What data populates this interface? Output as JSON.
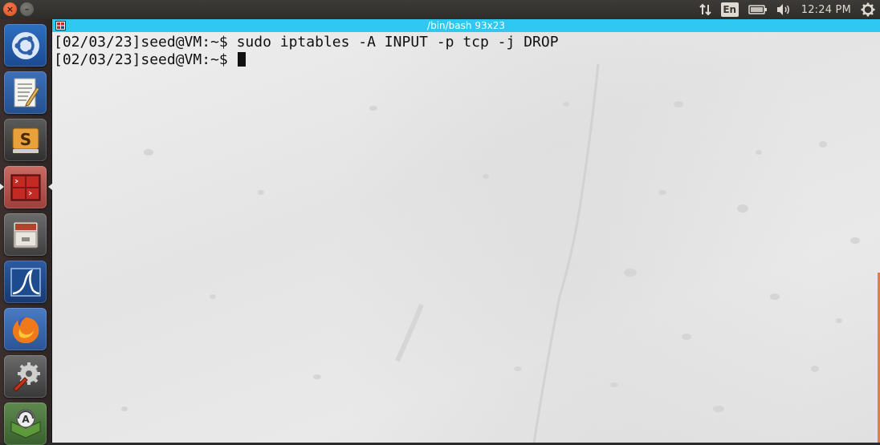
{
  "top_panel": {
    "window_controls": [
      "close",
      "minimize"
    ],
    "icons": {
      "close": "×",
      "minimize": "–",
      "network": "network-transfer-icon",
      "battery": "battery-icon",
      "volume": "volume-icon",
      "settings": "gear-icon"
    },
    "language": "En",
    "clock": "12:24 PM"
  },
  "launcher": {
    "items": [
      {
        "name": "ubuntu-dash",
        "icon": "ubuntu-logo-icon"
      },
      {
        "name": "text-editor",
        "icon": "text-editor-icon"
      },
      {
        "name": "sublime-text",
        "icon": "sublime-text-icon",
        "glyph": "S"
      },
      {
        "name": "terminal",
        "icon": "terminal-icon",
        "active": true
      },
      {
        "name": "files",
        "icon": "file-cabinet-icon"
      },
      {
        "name": "wireshark",
        "icon": "wireshark-fin-icon"
      },
      {
        "name": "firefox",
        "icon": "firefox-icon"
      },
      {
        "name": "system-settings",
        "icon": "wrench-gear-icon"
      },
      {
        "name": "software-updater",
        "icon": "updater-icon",
        "glyph": "A"
      }
    ]
  },
  "terminal": {
    "title": "/bin/bash 93x23",
    "lines": [
      "[02/03/23]seed@VM:~$ sudo iptables -A INPUT -p tcp -j DROP",
      "[02/03/23]seed@VM:~$ "
    ],
    "accent": "#2fc8f2"
  }
}
